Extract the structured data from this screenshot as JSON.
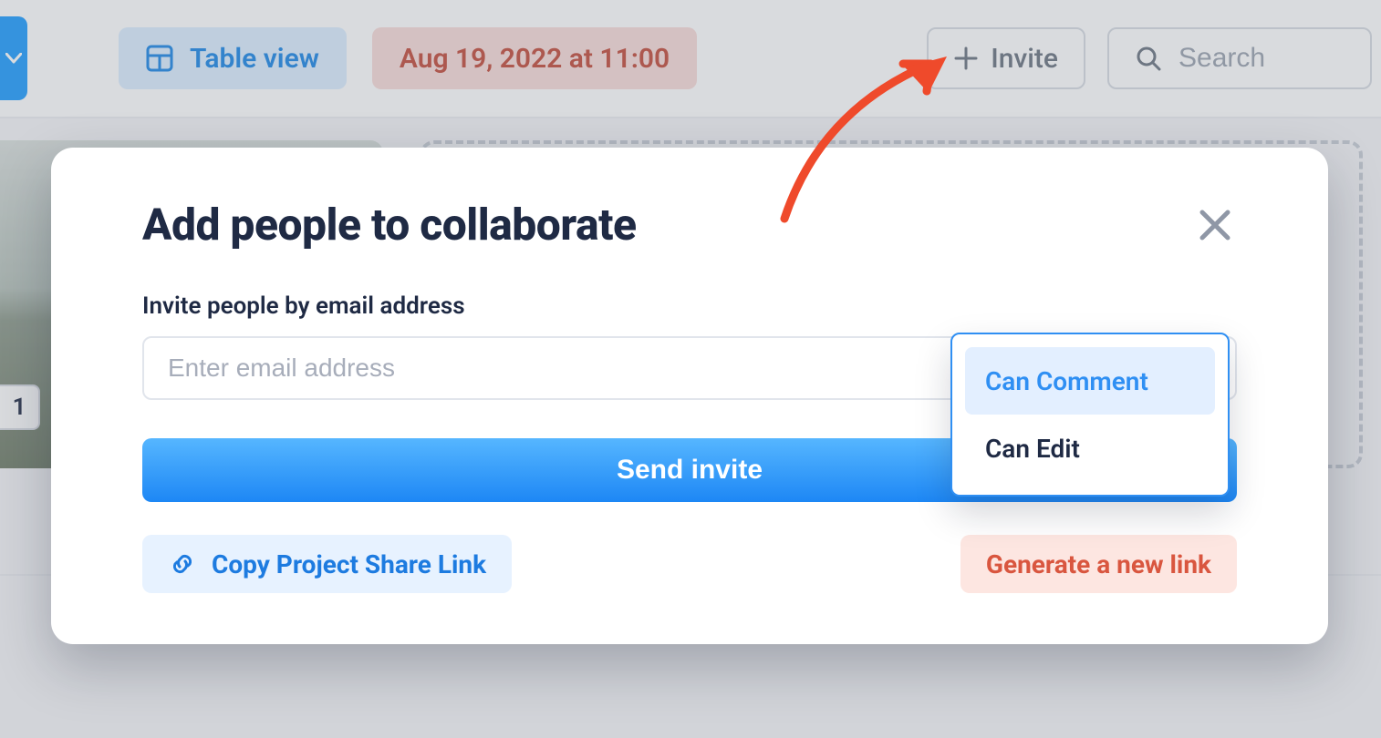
{
  "toolbar": {
    "view_label": "Table view",
    "date_label": "Aug 19, 2022 at 11:00",
    "invite_label": "Invite",
    "search_placeholder": "Search"
  },
  "thumb": {
    "badge": "1"
  },
  "modal": {
    "title": "Add people to collaborate",
    "field_label": "Invite people by email address",
    "email_placeholder": "Enter email address",
    "send_label": "Send invite",
    "copy_link_label": "Copy Project Share Link",
    "new_link_label": "Generate a new link"
  },
  "permissions": {
    "options": [
      {
        "label": "Can Comment",
        "selected": true
      },
      {
        "label": "Can Edit",
        "selected": false
      }
    ]
  }
}
